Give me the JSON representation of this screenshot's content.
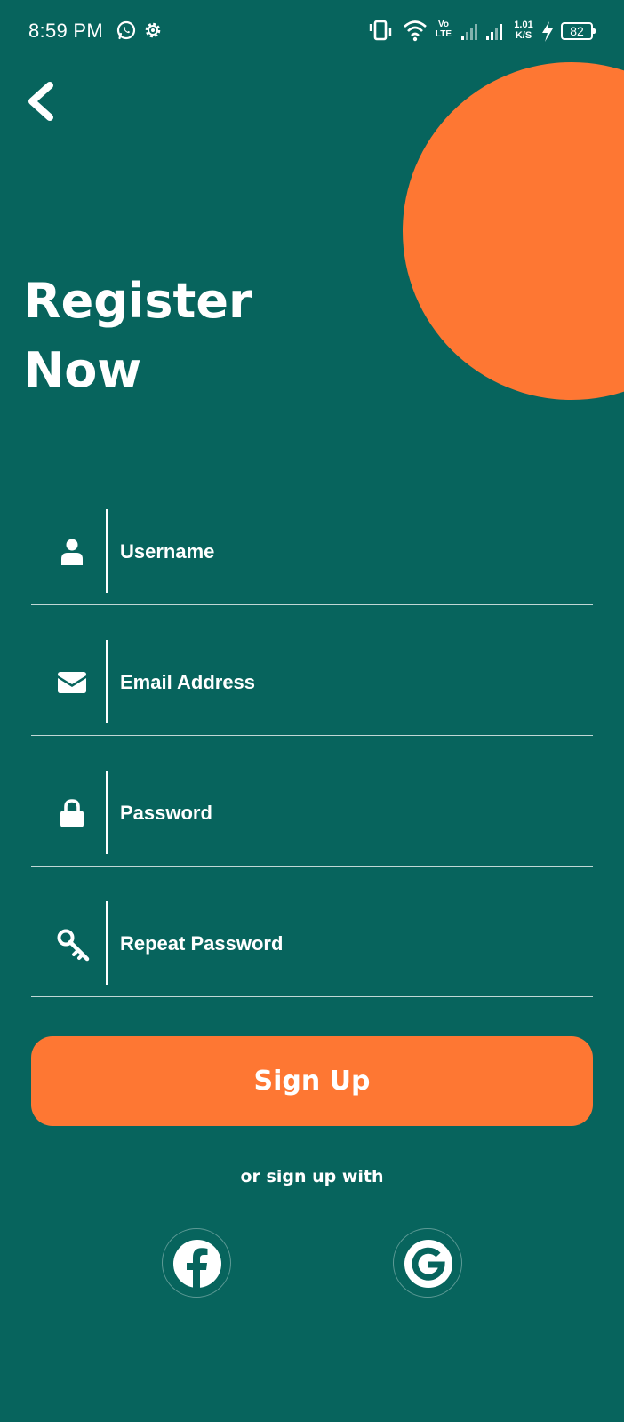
{
  "status_bar": {
    "time": "8:59 PM",
    "volte_top": "Vo",
    "volte_bottom": "LTE",
    "net_speed_value": "1.01",
    "net_speed_unit": "K/S",
    "battery": "82",
    "icons": [
      "whatsapp-icon",
      "settings-gear-icon",
      "vibrate-icon",
      "wifi-icon",
      "signal-icon",
      "signal-icon",
      "charging-icon"
    ]
  },
  "header": {
    "title_line1": "Register",
    "title_line2": "Now"
  },
  "form": {
    "fields": [
      {
        "placeholder": "Username",
        "icon": "user-icon",
        "type": "text"
      },
      {
        "placeholder": "Email Address",
        "icon": "envelope-icon",
        "type": "email"
      },
      {
        "placeholder": "Password",
        "icon": "lock-icon",
        "type": "password"
      },
      {
        "placeholder": "Repeat Password",
        "icon": "key-icon",
        "type": "password"
      }
    ]
  },
  "signup_button_label": "Sign Up",
  "alt_signup_text": "or sign up with",
  "social": {
    "facebook_icon": "facebook-icon",
    "google_icon": "google-icon"
  },
  "colors": {
    "background": "#07645d",
    "accent": "#fe7733",
    "text": "#ffffff"
  }
}
